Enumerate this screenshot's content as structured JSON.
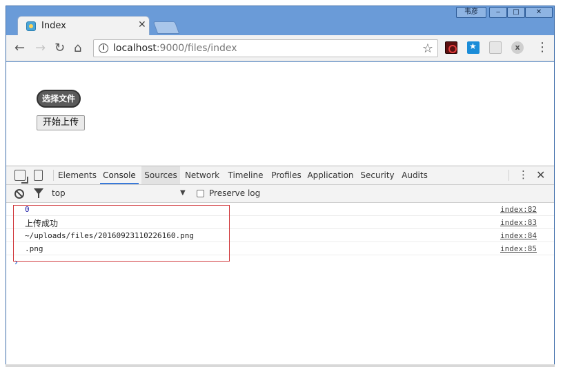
{
  "window": {
    "user_name": "韦彦",
    "controls": {
      "minimize": "‒",
      "maximize": "□",
      "close": "✕"
    }
  },
  "tabs": [
    {
      "title": "Index",
      "close_icon": "✕",
      "favicon": "page-favicon-icon"
    }
  ],
  "toolbar": {
    "back_icon": "←",
    "forward_icon": "→",
    "reload_icon": "↻",
    "home_icon": "⌂",
    "url_host": "localhost",
    "url_path": ":9000/files/index",
    "info_icon": "i",
    "star_icon": "☆",
    "extensions": [
      "pdf-extension-icon",
      "bookmark-extension-icon",
      "reader-extension-icon",
      "x-extension-icon"
    ],
    "ext_x_label": "x",
    "menu_icon": "⋮"
  },
  "page": {
    "choose_file_label": "选择文件",
    "start_upload_label": "开始上传"
  },
  "devtools": {
    "tabs": [
      "Elements",
      "Console",
      "Sources",
      "Network",
      "Timeline",
      "Profiles",
      "Application",
      "Security",
      "Audits"
    ],
    "active_tab": "Console",
    "hover_tab": "Sources",
    "more_icon": "⋮",
    "close_icon": "✕",
    "console": {
      "context": "top",
      "context_arrow": "▼",
      "preserve_log_label": "Preserve log",
      "preserve_log_checked": false,
      "prompt": "›",
      "messages": [
        {
          "text": "0",
          "source": "index:82"
        },
        {
          "text": "上传成功",
          "source": "index:83"
        },
        {
          "text": "~/uploads/files/20160923110226160.png",
          "source": "index:84"
        },
        {
          "text": ".png",
          "source": "index:85"
        }
      ]
    }
  },
  "colors": {
    "frame": "#6a9bd8",
    "active_tab_underline": "#3879d9",
    "highlight_box": "#d0363a",
    "number_log": "#1a1aa6"
  }
}
